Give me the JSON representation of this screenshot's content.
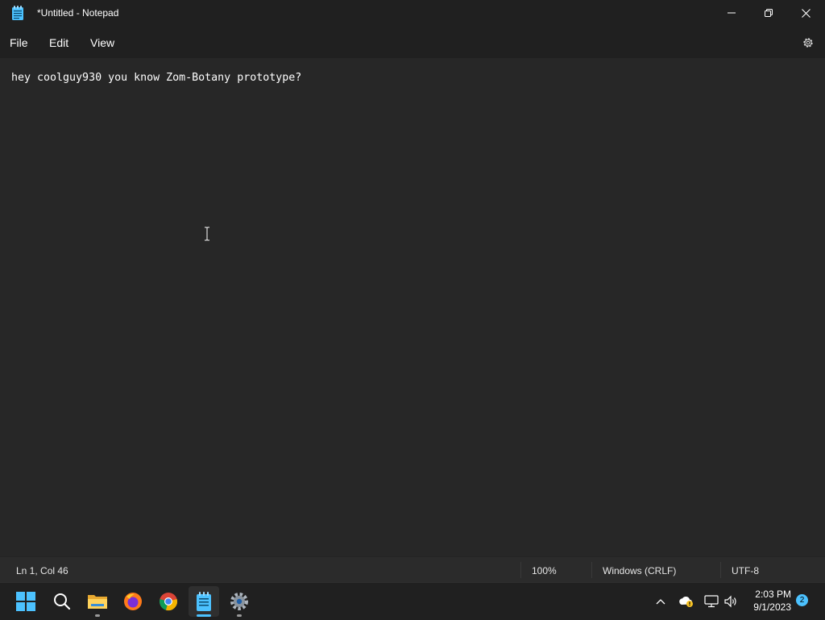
{
  "window": {
    "title": "*Untitled - Notepad"
  },
  "menu": {
    "file": "File",
    "edit": "Edit",
    "view": "View"
  },
  "editor": {
    "text": "hey coolguy930 you know Zom-Botany prototype?"
  },
  "status": {
    "position": "Ln 1, Col 46",
    "zoom": "100%",
    "line_ending": "Windows (CRLF)",
    "encoding": "UTF-8"
  },
  "taskbar": {
    "apps": [
      "start-icon",
      "search-icon",
      "file-explorer-icon",
      "firefox-icon",
      "chrome-icon",
      "notepad-icon",
      "settings-icon"
    ],
    "tray": [
      "chevron-up-icon",
      "onedrive-warning-icon",
      "network-icon",
      "volume-icon"
    ],
    "time": "2:03 PM",
    "date": "9/1/2023",
    "notification_count": "2"
  },
  "colors": {
    "accent": "#4cc2ff",
    "editor_bg": "#272727",
    "chrome_bg": "#202020"
  }
}
